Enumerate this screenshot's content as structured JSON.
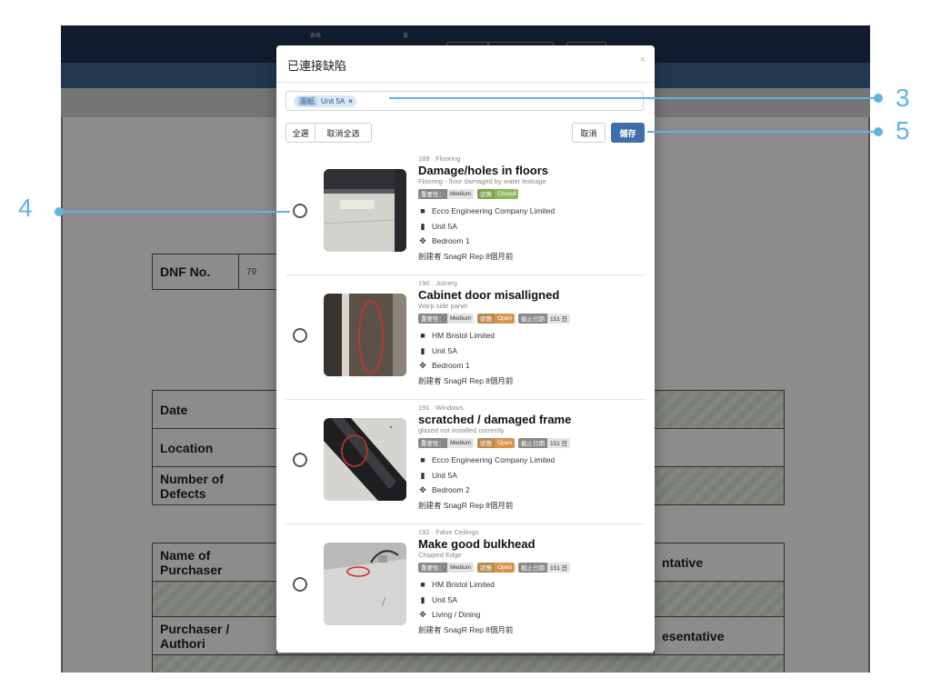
{
  "background": {
    "top_tiny_1": "表格",
    "top_tiny_2": "頁",
    "dnf_label": "DNF No.",
    "dnf_value": "79",
    "rows": [
      "Date",
      "Location",
      "Number of Defects"
    ],
    "name_of_purchaser": "Name of Purchaser",
    "representative_partial": "ntative",
    "purchaser_authority": "Purchaser / Authori",
    "representative_partial_2": "esentative"
  },
  "modal": {
    "title": "已連接缺陷",
    "close": "×",
    "filter_tag": {
      "type": "圖紙",
      "label": "Unit 5A",
      "remove": "×"
    },
    "buttons": {
      "select_all": "全選",
      "deselect_all": "取消全选",
      "cancel": "取消",
      "save": "儲存"
    }
  },
  "items": [
    {
      "code": "189 · Flooring",
      "title": "Damage/holes in floors",
      "description": "Flooring - floor damaged by water leakage",
      "severity_key": "重要性：",
      "severity": "Medium",
      "status_key": "狀態",
      "status": "Closed",
      "due_key": "",
      "due": "",
      "company": "Ecco Engineering Company Limited",
      "unit": "Unit 5A",
      "room": "Bedroom 1",
      "creator": "創建者 SnagR Rep 8個月前"
    },
    {
      "code": "190 · Joinery",
      "title": "Cabinet door misalligned",
      "description": "Warp side panel",
      "severity_key": "重要性：",
      "severity": "Medium",
      "status_key": "狀態",
      "status": "Open",
      "due_key": "截止日期",
      "due": "151 日",
      "company": "HM Bristol Limited",
      "unit": "Unit 5A",
      "room": "Bedroom 1",
      "creator": "創建者 SnagR Rep 8個月前"
    },
    {
      "code": "191 · Windows",
      "title": "scratched / damaged frame",
      "description": "glazed not installed correctly",
      "severity_key": "重要性：",
      "severity": "Medium",
      "status_key": "狀態",
      "status": "Open",
      "due_key": "截止日期",
      "due": "151 日",
      "company": "Ecco Engineering Company Limited",
      "unit": "Unit 5A",
      "room": "Bedroom 2",
      "creator": "創建者 SnagR Rep 8個月前"
    },
    {
      "code": "192 · False Ceilings",
      "title": "Make good bulkhead",
      "description": "Chipped Edge",
      "severity_key": "重要性：",
      "severity": "Medium",
      "status_key": "狀態",
      "status": "Open",
      "due_key": "截止日期",
      "due": "151 日",
      "company": "HM Bristol Limited",
      "unit": "Unit 5A",
      "room": "Living / Dining",
      "creator": "創建者 SnagR Rep 8個月前"
    }
  ],
  "callouts": {
    "c3": "3",
    "c4": "4",
    "c5": "5"
  },
  "colors": {
    "accent": "#5fb4e0",
    "primary": "#3f6fa8",
    "open": "#d9944c",
    "closed": "#8db85c"
  },
  "icons": {
    "company": "briefcase-icon",
    "unit": "map-icon",
    "room": "crosshair-icon"
  }
}
